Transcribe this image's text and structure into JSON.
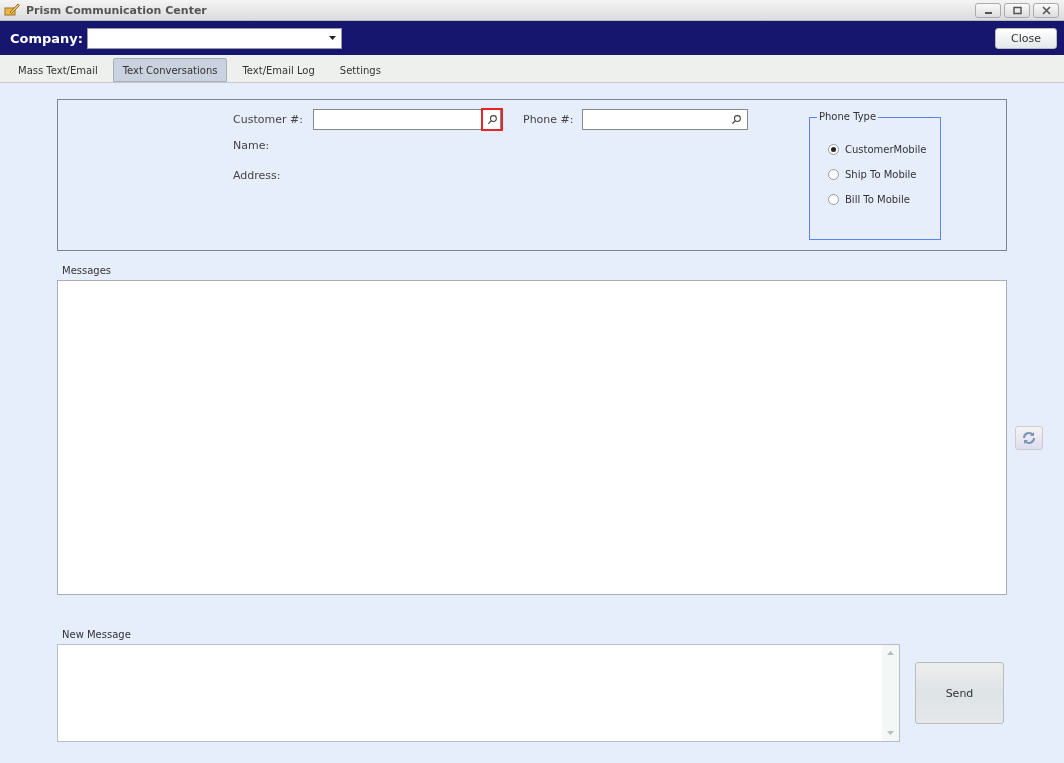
{
  "window": {
    "title": "Prism Communication Center"
  },
  "toolbar": {
    "company_label": "Company:",
    "close_button": "Close"
  },
  "tabs": [
    {
      "label": "Mass Text/Email",
      "selected": false
    },
    {
      "label": "Text Conversations",
      "selected": true
    },
    {
      "label": "Text/Email Log",
      "selected": false
    },
    {
      "label": "Settings",
      "selected": false
    }
  ],
  "customer": {
    "customer_label": "Customer #:",
    "customer_search_highlighted": true,
    "phone_label": "Phone #:",
    "name_label": "Name:",
    "address_label": "Address:"
  },
  "phone_type": {
    "title": "Phone Type",
    "options": [
      {
        "label": "CustomerMobile",
        "selected": true
      },
      {
        "label": "Ship To Mobile",
        "selected": false
      },
      {
        "label": "Bill To Mobile",
        "selected": false
      }
    ]
  },
  "messages": {
    "label": "Messages"
  },
  "new_message": {
    "label": "New Message",
    "send_button": "Send"
  }
}
